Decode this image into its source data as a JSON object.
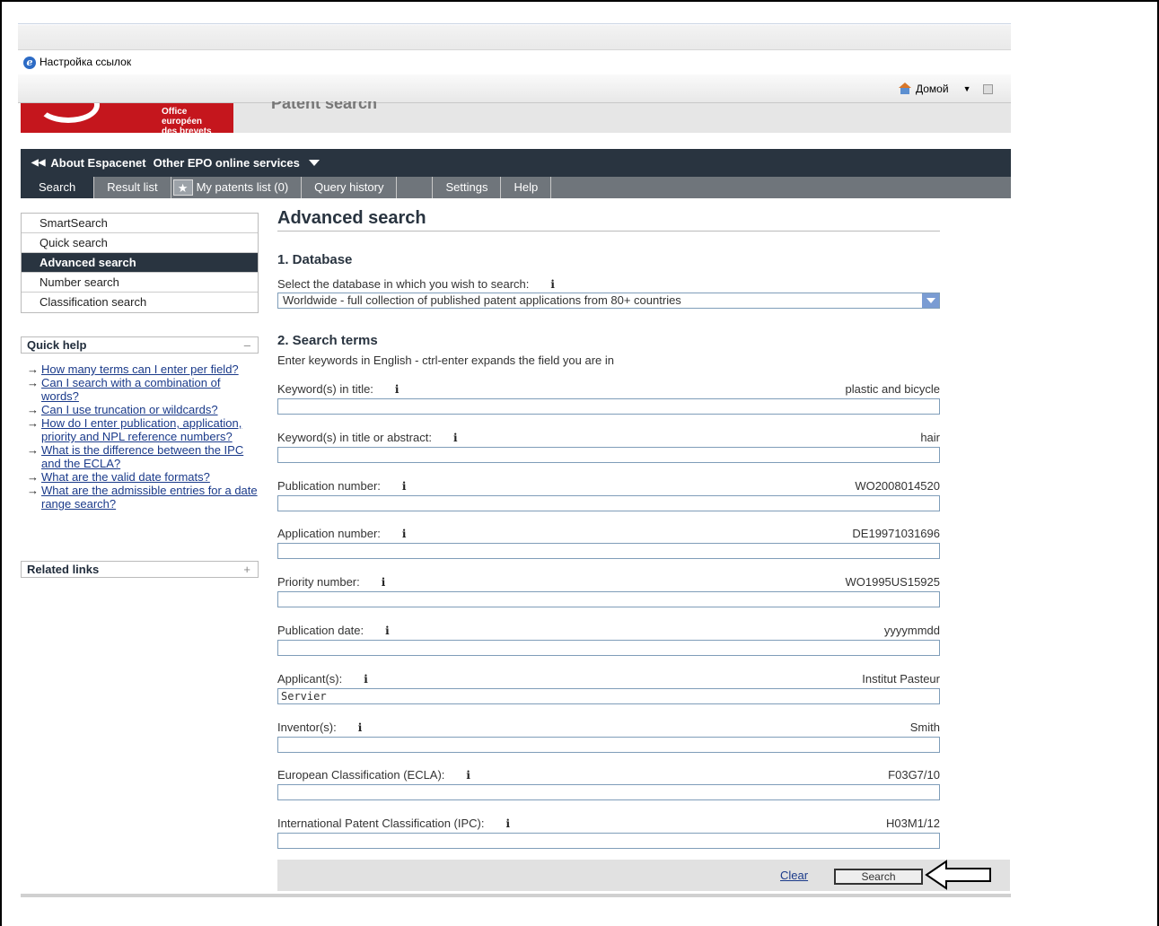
{
  "browser": {
    "links_label": "Настройка ссылок",
    "home_label": "Домой",
    "ie_glyph": "e"
  },
  "header": {
    "logo_text_line1": "Office européen",
    "logo_text_line2": "des brevets",
    "page_heading": "Patent search"
  },
  "service_bar": {
    "about": "About Espacenet",
    "other": "Other EPO online services"
  },
  "tabs": [
    {
      "label": "Search"
    },
    {
      "label": "Result list"
    },
    {
      "label": "My patents list (0)"
    },
    {
      "label": "Query history"
    },
    {
      "label": "Settings"
    },
    {
      "label": "Help"
    }
  ],
  "leftnav": {
    "items": [
      {
        "label": "SmartSearch"
      },
      {
        "label": "Quick search"
      },
      {
        "label": "Advanced search"
      },
      {
        "label": "Number search"
      },
      {
        "label": "Classification search"
      }
    ]
  },
  "quick_help": {
    "title": "Quick help",
    "toggle": "–",
    "links": [
      "How many terms can I enter per field?",
      "Can I search with a combination of words?",
      "Can I use truncation or wildcards?",
      "How do I enter publication, application, priority and NPL reference numbers?",
      "What is the difference between the IPC and the ECLA?",
      "What are the valid date formats?",
      "What are the admissible entries for a date range search?"
    ]
  },
  "related_links": {
    "title": "Related links",
    "toggle": "+"
  },
  "main": {
    "title": "Advanced search",
    "database": {
      "heading": "1. Database",
      "label": "Select the database in which you wish to search:",
      "selected": "Worldwide - full collection of published patent applications from 80+ countries"
    },
    "terms": {
      "heading": "2. Search terms",
      "hint": "Enter keywords in English - ctrl-enter expands the field you are in"
    },
    "fields": [
      {
        "label": "Keyword(s) in title:",
        "example": "plastic and bicycle",
        "value": ""
      },
      {
        "label": "Keyword(s) in title or abstract:",
        "example": "hair",
        "value": ""
      },
      {
        "label": "Publication number:",
        "example": "WO2008014520",
        "value": ""
      },
      {
        "label": "Application number:",
        "example": "DE19971031696",
        "value": ""
      },
      {
        "label": "Priority number:",
        "example": "WO1995US15925",
        "value": ""
      },
      {
        "label": "Publication date:",
        "example": "yyyymmdd",
        "value": ""
      },
      {
        "label": "Applicant(s):",
        "example": "Institut Pasteur",
        "value": "Servier"
      },
      {
        "label": "Inventor(s):",
        "example": "Smith",
        "value": ""
      },
      {
        "label": "European Classification (ECLA):",
        "example": "F03G7/10",
        "value": ""
      },
      {
        "label": "International Patent Classification (IPC):",
        "example": "H03M1/12",
        "value": ""
      }
    ],
    "info_glyph": "i",
    "clear_label": "Clear",
    "search_label": "Search"
  }
}
